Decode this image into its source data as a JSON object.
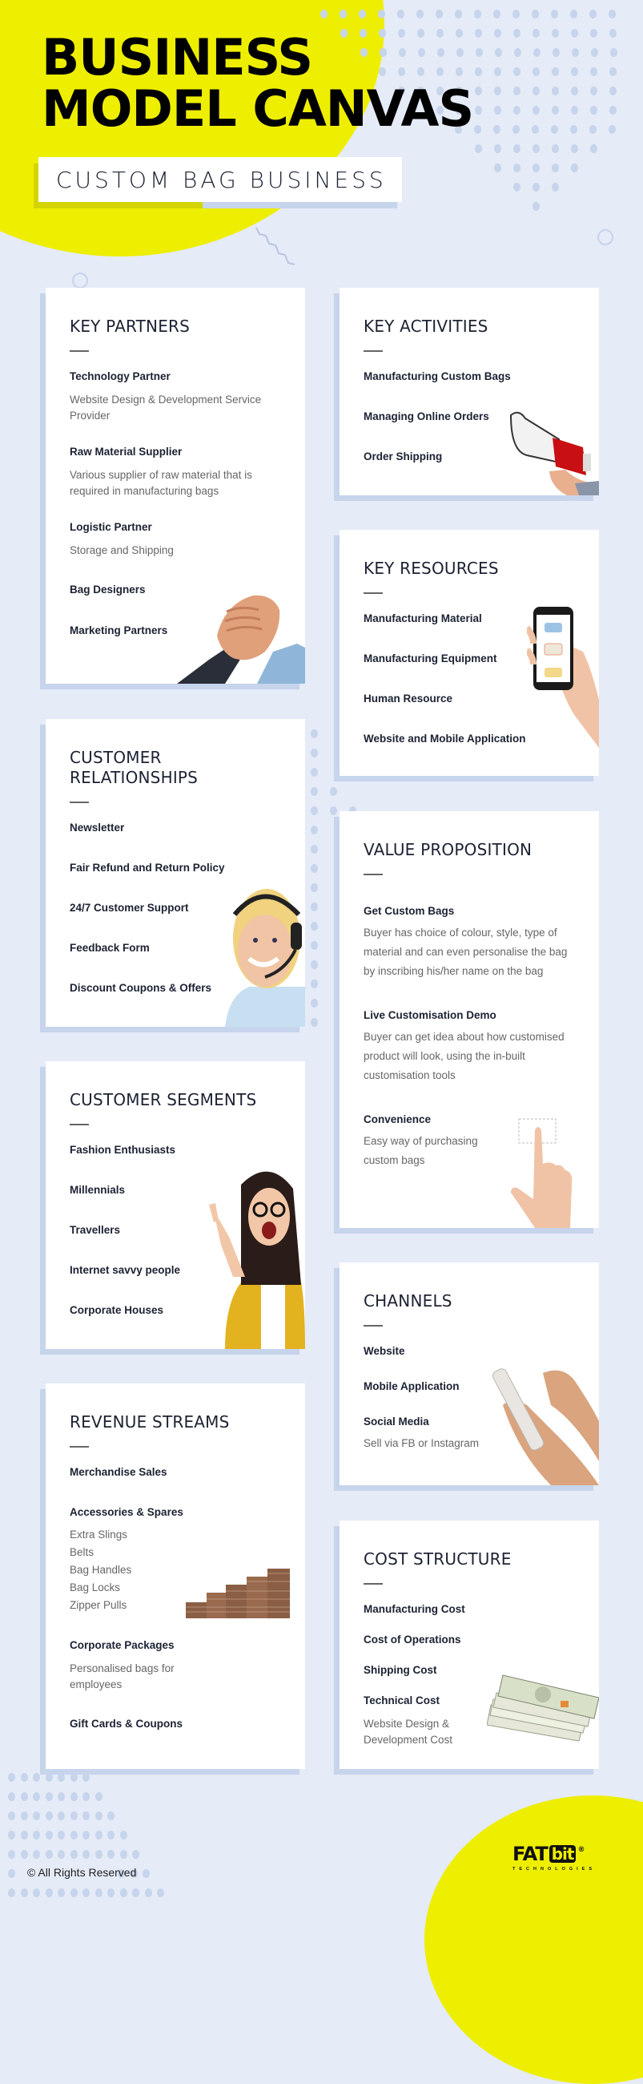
{
  "header": {
    "title_line1": "BUSINESS",
    "title_line2": "MODEL CANVAS",
    "subtitle": "CUSTOM BAG BUSINESS"
  },
  "colors": {
    "background": "#e5ebf7",
    "accent_yellow": "#eeee00",
    "shadow_blue": "#c6d4ec",
    "heading": "#1c2233",
    "body_text": "#666666"
  },
  "sections": {
    "key_partners": {
      "title": "KEY PARTNERS",
      "illustration": "handshake-icon",
      "items": [
        {
          "title": "Technology Partner",
          "desc": "Website Design & Development Service Provider"
        },
        {
          "title": "Raw Material Supplier",
          "desc": "Various supplier of raw material that is required in manufacturing bags"
        },
        {
          "title": "Logistic Partner",
          "desc": "Storage and Shipping"
        },
        {
          "title": "Bag Designers"
        },
        {
          "title": "Marketing Partners"
        }
      ]
    },
    "key_activities": {
      "title": "KEY ACTIVITIES",
      "illustration": "megaphone-icon",
      "items": [
        {
          "title": "Manufacturing Custom Bags"
        },
        {
          "title": "Managing Online Orders"
        },
        {
          "title": "Order Shipping"
        }
      ]
    },
    "key_resources": {
      "title": "KEY RESOURCES",
      "illustration": "smartphone-icon",
      "items": [
        {
          "title": "Manufacturing Material"
        },
        {
          "title": "Manufacturing Equipment"
        },
        {
          "title": "Human Resource"
        },
        {
          "title": "Website and Mobile Application"
        }
      ]
    },
    "customer_relationships": {
      "title_line1": "CUSTOMER",
      "title_line2": "RELATIONSHIPS",
      "illustration": "support-agent-icon",
      "items": [
        {
          "title": "Newsletter"
        },
        {
          "title": "Fair Refund and Return Policy"
        },
        {
          "title": "24/7 Customer Support"
        },
        {
          "title": "Feedback Form"
        },
        {
          "title": "Discount Coupons & Offers"
        }
      ]
    },
    "value_proposition": {
      "title": "VALUE PROPOSITION",
      "illustration": "pointing-hand-icon",
      "items": [
        {
          "title": "Get Custom Bags",
          "desc": "Buyer has choice of colour, style, type of material and can even personalise the bag by inscribing his/her name on the bag"
        },
        {
          "title": "Live Customisation Demo",
          "desc": "Buyer can get idea about how customised product will look, using the in-built customisation tools"
        },
        {
          "title": "Convenience",
          "desc": "Easy way of purchasing custom bags"
        }
      ]
    },
    "customer_segments": {
      "title": "CUSTOMER SEGMENTS",
      "illustration": "excited-woman-icon",
      "items": [
        {
          "title": "Fashion Enthusiasts"
        },
        {
          "title": "Millennials"
        },
        {
          "title": "Travellers"
        },
        {
          "title": "Internet savvy people"
        },
        {
          "title": "Corporate Houses"
        }
      ]
    },
    "channels": {
      "title": "CHANNELS",
      "illustration": "phone-in-hands-icon",
      "items": [
        {
          "title": "Website"
        },
        {
          "title": "Mobile Application"
        },
        {
          "title": "Social Media",
          "desc": "Sell via FB or Instagram"
        }
      ]
    },
    "revenue_streams": {
      "title": "REVENUE STREAMS",
      "illustration": "coin-stacks-icon",
      "items": [
        {
          "title": "Merchandise Sales"
        },
        {
          "title": "Accessories & Spares",
          "sub_items": [
            "Extra Slings",
            "Belts",
            "Bag Handles",
            "Bag Locks",
            "Zipper Pulls"
          ]
        },
        {
          "title": "Corporate Packages",
          "desc": "Personalised bags for employees"
        },
        {
          "title": "Gift Cards & Coupons"
        }
      ]
    },
    "cost_structure": {
      "title": "COST STRUCTURE",
      "illustration": "cash-bundle-icon",
      "items": [
        {
          "title": "Manufacturing Cost"
        },
        {
          "title": "Cost of Operations"
        },
        {
          "title": "Shipping Cost"
        },
        {
          "title": "Technical Cost",
          "desc": "Website Design & Development Cost"
        }
      ]
    }
  },
  "footer": {
    "copyright": "© All Rights Reserved",
    "logo_fat": "FAT",
    "logo_bit": "bit",
    "logo_reg": "®",
    "logo_sub": "TECHNOLOGIES"
  }
}
